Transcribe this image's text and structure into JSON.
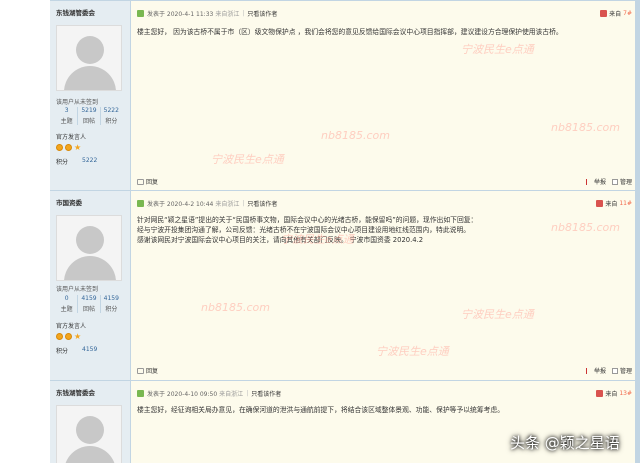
{
  "posts": [
    {
      "username": "东钱湖管委会",
      "status": "该用户从未签到",
      "stats": [
        {
          "num": "3",
          "lbl": "主题"
        },
        {
          "num": "5219",
          "lbl": "回帖"
        },
        {
          "num": "5222",
          "lbl": "积分"
        }
      ],
      "rank": "官方发言人",
      "points_label": "积分",
      "points_value": "5222",
      "posted": "发表于 2020-4-1 11:33",
      "ip": "来自浙江",
      "only_author": "只看该作者",
      "floor_label": "来自",
      "floor_num": "7#",
      "content": "楼主您好， 因为该古桥不属于市（区）级文物保护点 ，我们会将您的意见反馈给国际会议中心项目指挥部，建议建设方合理保护使用该古桥。",
      "actions": {
        "reply": "回复",
        "report": "举报",
        "manage": "管理"
      }
    },
    {
      "username": "市国资委",
      "status": "该用户从未签到",
      "stats": [
        {
          "num": "0",
          "lbl": "主题"
        },
        {
          "num": "4159",
          "lbl": "回帖"
        },
        {
          "num": "4159",
          "lbl": "积分"
        }
      ],
      "rank": "官方发言人",
      "points_label": "积分",
      "points_value": "4159",
      "posted": "发表于 2020-4-2 10:44",
      "ip": "来自浙江",
      "only_author": "只看该作者",
      "floor_label": "来自",
      "floor_num": "11#",
      "content": "针对网民“颖之星语”提出的关于“民国桥事文物，国际会议中心的光绪古桥，能保留吗”的问题，现作出如下回复：\n经与宁波开投集团沟通了解，公司反馈：光绪古桥不在宁波国际会议中心项目建设用地红线范围内，特此说明。\n感谢该网民对宁波国际会议中心项目的关注，请向其他有关部门反映。   宁波市国资委 2020.4.2",
      "actions": {
        "reply": "回复",
        "report": "举报",
        "manage": "管理"
      }
    },
    {
      "username": "东钱湖管委会",
      "posted": "发表于 2020-4-10 09:50",
      "ip": "来自浙江",
      "only_author": "只看该作者",
      "floor_label": "来自",
      "floor_num": "13#",
      "content": "楼主您好，经征询相关局办意见，在确保河道的泄洪与通航前提下，将结合该区域整体景观、功能、保护等予以统筹考虑。"
    }
  ],
  "watermark_site": "宁波民生e点通",
  "watermark_url": "nb8185.com",
  "toutiao_credit": "头条 @颖之星语"
}
